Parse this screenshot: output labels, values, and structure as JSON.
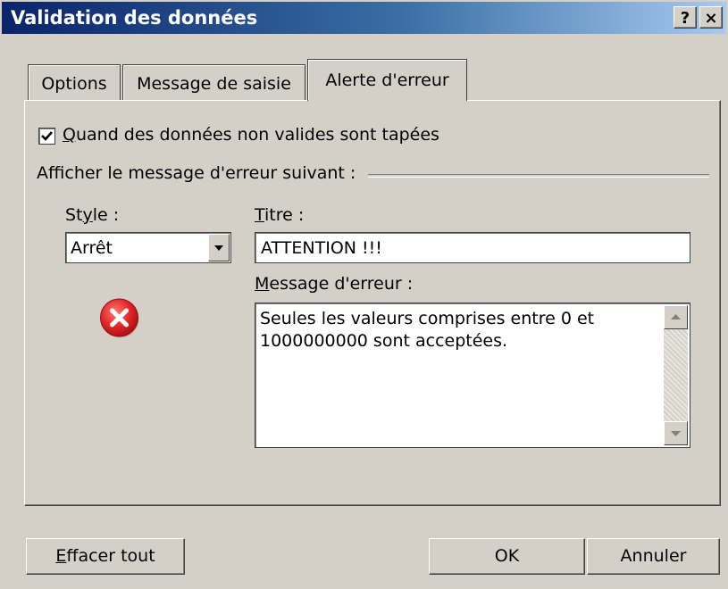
{
  "window": {
    "title": "Validation des données",
    "help_button": "?",
    "close_button": "×"
  },
  "tabs": [
    {
      "label": "Options",
      "active": false
    },
    {
      "label": "Message de saisie",
      "active": false
    },
    {
      "label": "Alerte d'erreur",
      "active": true
    }
  ],
  "alert": {
    "checkbox_checked": true,
    "checkbox_label_access": "Q",
    "checkbox_label_rest": "uand des données non valides sont tapées",
    "group_label": "Afficher le message d'erreur suivant :",
    "style_label_pre": "St",
    "style_label_access": "y",
    "style_label_post": "le :",
    "style_value": "Arrêt",
    "title_label_access": "T",
    "title_label_rest": "itre :",
    "title_value": "ATTENTION !!!",
    "message_label_access": "M",
    "message_label_rest": "essage d'erreur :",
    "message_value": "Seules les valeurs comprises entre 0 et\n1000000000 sont acceptées.",
    "style_icon": "error-stop-icon"
  },
  "buttons": {
    "clear_access": "E",
    "clear_rest": "ffacer tout",
    "ok": "OK",
    "cancel": "Annuler"
  },
  "colors": {
    "title_gradient_start": "#0a246a",
    "title_gradient_end": "#a6caf0",
    "dialog_face": "#d4d0c8",
    "error_red": "#e2262a"
  }
}
